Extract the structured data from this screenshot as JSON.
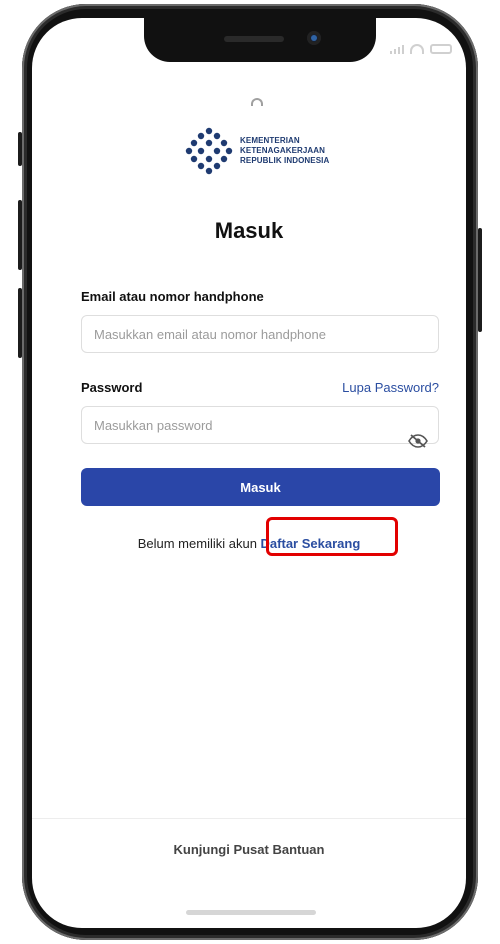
{
  "logo": {
    "lines": [
      "KEMENTERIAN",
      "KETENAGAKERJAAN",
      "REPUBLIK INDONESIA"
    ],
    "brand_color": "#1f3b71"
  },
  "page": {
    "title": "Masuk"
  },
  "email": {
    "label": "Email atau nomor handphone",
    "placeholder": "Masukkan email atau nomor handphone",
    "value": ""
  },
  "password": {
    "label": "Password",
    "placeholder": "Masukkan password",
    "value": "",
    "forgot_label": "Lupa Password?"
  },
  "submit": {
    "label": "Masuk",
    "color": "#2a46a8"
  },
  "register": {
    "prompt": "Belum memiliki akun",
    "link_label": "Daftar Sekarang"
  },
  "help": {
    "label": "Kunjungi Pusat Bantuan"
  },
  "highlight_color": "#e20000"
}
